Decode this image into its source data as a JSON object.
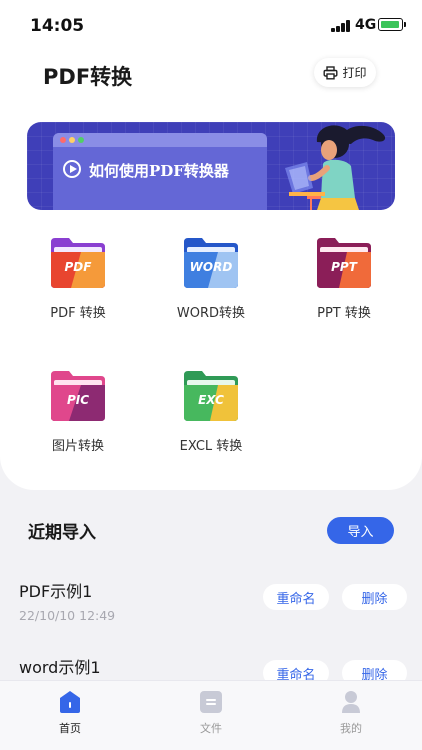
{
  "status_bar": {
    "time": "14:05",
    "network": "4G"
  },
  "header": {
    "title": "PDF转换",
    "print_label": "打印"
  },
  "banner": {
    "text": "如何使用PDF转换器"
  },
  "tools": [
    {
      "label": "PDF 转换",
      "icon_text": "PDF",
      "icon": "pdf-folder-icon",
      "colors": [
        "#8a3fd1",
        "#e8452f",
        "#f59a3a"
      ]
    },
    {
      "label": "WORD转换",
      "icon_text": "WORD",
      "icon": "word-folder-icon",
      "colors": [
        "#2557c9",
        "#3f7fe0",
        "#9fc4f2"
      ]
    },
    {
      "label": "PPT 转换",
      "icon_text": "PPT",
      "icon": "ppt-folder-icon",
      "colors": [
        "#8b1e58",
        "#c8285a",
        "#f06a3a"
      ]
    },
    {
      "label": "图片转换",
      "icon_text": "PIC",
      "icon": "pic-folder-icon",
      "colors": [
        "#e0478c",
        "#8d2a72",
        "#f07ab0"
      ]
    },
    {
      "label": "EXCL 转换",
      "icon_text": "EXC",
      "icon": "excel-folder-icon",
      "colors": [
        "#2f9a56",
        "#47b85e",
        "#f0c23a"
      ]
    }
  ],
  "recent": {
    "title": "近期导入",
    "import_label": "导入",
    "rename_label": "重命名",
    "delete_label": "删除",
    "files": [
      {
        "name": "PDF示例1",
        "date": "22/10/10 12:49"
      },
      {
        "name": "word示例1",
        "date": ""
      }
    ]
  },
  "nav": [
    {
      "label": "首页",
      "icon": "home-icon",
      "active": true
    },
    {
      "label": "文件",
      "icon": "file-icon",
      "active": false
    },
    {
      "label": "我的",
      "icon": "profile-icon",
      "active": false
    }
  ],
  "colors": {
    "accent": "#3566e8",
    "banner": "#3f3fb8",
    "background": "#f2f2f5"
  }
}
